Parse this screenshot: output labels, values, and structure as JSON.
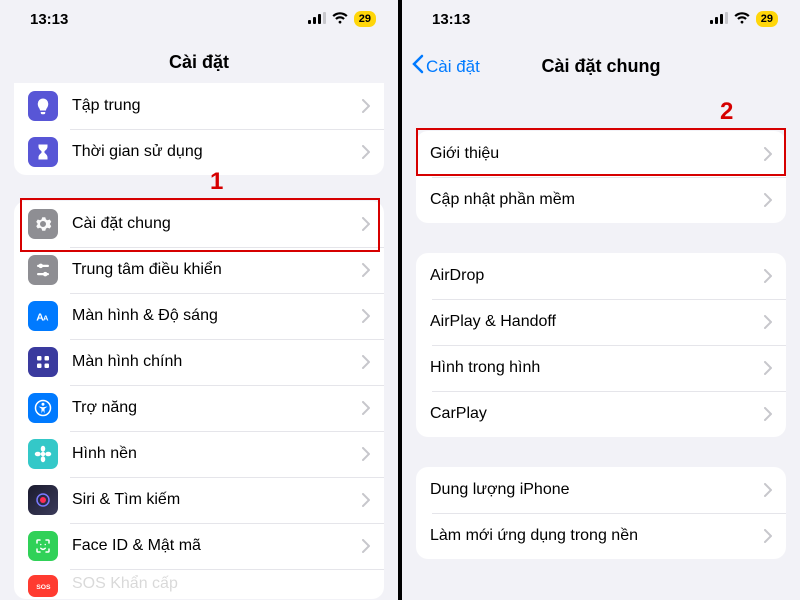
{
  "status": {
    "time": "13:13",
    "battery": "29"
  },
  "left": {
    "title": "Cài đặt",
    "callout": "1",
    "groups": [
      {
        "rows": [
          {
            "id": "focus",
            "label": "Tập trung",
            "icon": "focus"
          },
          {
            "id": "screentime",
            "label": "Thời gian sử dụng",
            "icon": "screentime"
          }
        ]
      },
      {
        "rows": [
          {
            "id": "general",
            "label": "Cài đặt chung",
            "icon": "general",
            "highlight": true
          },
          {
            "id": "control",
            "label": "Trung tâm điều khiển",
            "icon": "control"
          },
          {
            "id": "display",
            "label": "Màn hình & Độ sáng",
            "icon": "display"
          },
          {
            "id": "homescreen",
            "label": "Màn hình chính",
            "icon": "home"
          },
          {
            "id": "access",
            "label": "Trợ năng",
            "icon": "access"
          },
          {
            "id": "wallpaper",
            "label": "Hình nền",
            "icon": "wall"
          },
          {
            "id": "siri",
            "label": "Siri & Tìm kiếm",
            "icon": "siri"
          },
          {
            "id": "faceid",
            "label": "Face ID & Mật mã",
            "icon": "faceid"
          },
          {
            "id": "sos",
            "label": "SOS Khẩn cấp",
            "icon": "sos"
          }
        ]
      }
    ]
  },
  "right": {
    "back": "Cài đặt",
    "title": "Cài đặt chung",
    "callout": "2",
    "groups": [
      {
        "rows": [
          {
            "id": "about",
            "label": "Giới thiệu",
            "highlight": true
          },
          {
            "id": "swupdate",
            "label": "Cập nhật phần mềm"
          }
        ]
      },
      {
        "rows": [
          {
            "id": "airdrop",
            "label": "AirDrop"
          },
          {
            "id": "airplay",
            "label": "AirPlay & Handoff"
          },
          {
            "id": "pip",
            "label": "Hình trong hình"
          },
          {
            "id": "carplay",
            "label": "CarPlay"
          }
        ]
      },
      {
        "rows": [
          {
            "id": "storage",
            "label": "Dung lượng iPhone"
          },
          {
            "id": "bgrefresh",
            "label": "Làm mới ứng dụng trong nền"
          }
        ]
      }
    ]
  }
}
